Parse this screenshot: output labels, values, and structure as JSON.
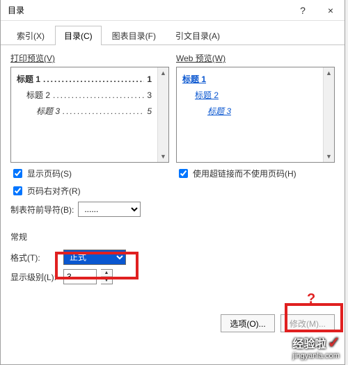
{
  "window": {
    "title": "目录",
    "help": "?",
    "close": "×"
  },
  "tabs": {
    "index": "索引(X)",
    "toc": "目录(C)",
    "fig": "图表目录(F)",
    "cite": "引文目录(A)"
  },
  "print_preview": {
    "label": "打印预览(V)",
    "entries": [
      {
        "text": "标题 1",
        "page": "1"
      },
      {
        "text": "标题 2",
        "page": "3"
      },
      {
        "text": "标题 3",
        "page": "5"
      }
    ]
  },
  "web_preview": {
    "label": "Web 预览(W)",
    "entries": [
      {
        "text": "标题 1"
      },
      {
        "text": "标题 2"
      },
      {
        "text": "标题 3"
      }
    ]
  },
  "options": {
    "show_page_numbers": "显示页码(S)",
    "right_align": "页码右对齐(R)",
    "tab_leader": "制表符前导符(B):",
    "tab_leader_value": "......",
    "use_hyperlinks": "使用超链接而不使用页码(H)"
  },
  "general": {
    "heading": "常规",
    "format_label": "格式(T):",
    "format_value": "正式",
    "levels_label": "显示级别(L):",
    "levels_value": "3"
  },
  "buttons": {
    "options": "选项(O)...",
    "modify": "修改(M)..."
  },
  "annotation": {
    "question": "?"
  },
  "watermark": {
    "text": "经验啦",
    "url": "jingyanla.com"
  }
}
